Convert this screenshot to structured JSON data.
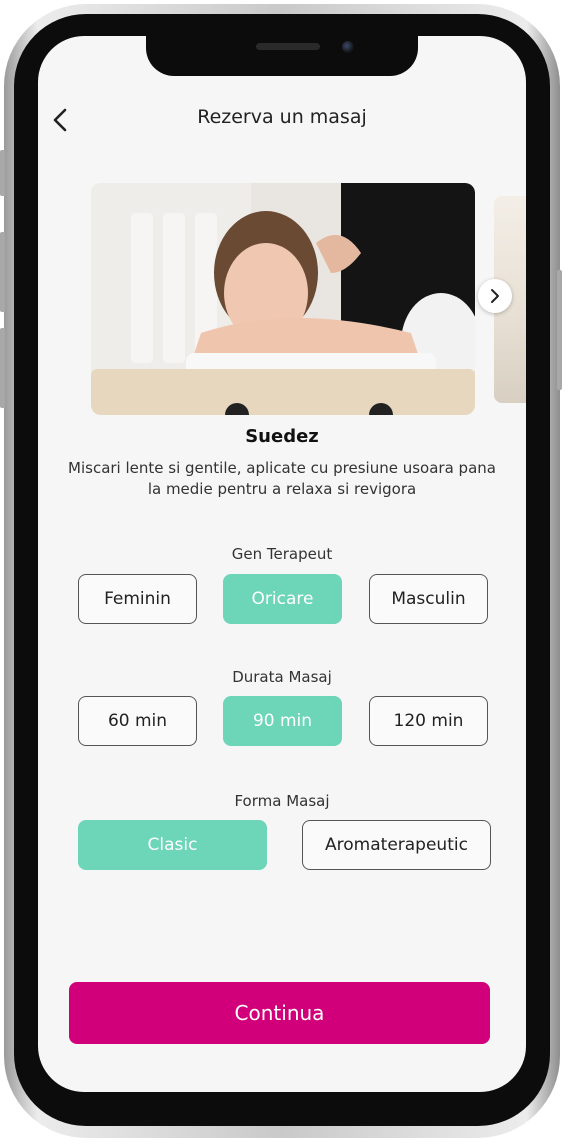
{
  "header": {
    "title": "Rezerva un masaj"
  },
  "carousel": {
    "prev_icon": "back-chevron-icon",
    "next_icon": "chevron-right-icon"
  },
  "massage": {
    "name": "Suedez",
    "description": "Miscari lente si gentile, aplicate cu presiune usoara pana la medie pentru a relaxa si revigora"
  },
  "therapist_gender": {
    "label": "Gen Terapeut",
    "options": [
      "Feminin",
      "Oricare",
      "Masculin"
    ],
    "selected": "Oricare"
  },
  "duration": {
    "label": "Durata Masaj",
    "options": [
      "60 min",
      "90 min",
      "120 min"
    ],
    "selected": "90 min"
  },
  "form": {
    "label": "Forma Masaj",
    "options": [
      "Clasic",
      "Aromaterapeutic"
    ],
    "selected": "Clasic"
  },
  "continue_label": "Continua",
  "colors": {
    "accent": "#6dd5b8",
    "primary": "#d1007a",
    "background": "#f6f6f6"
  }
}
